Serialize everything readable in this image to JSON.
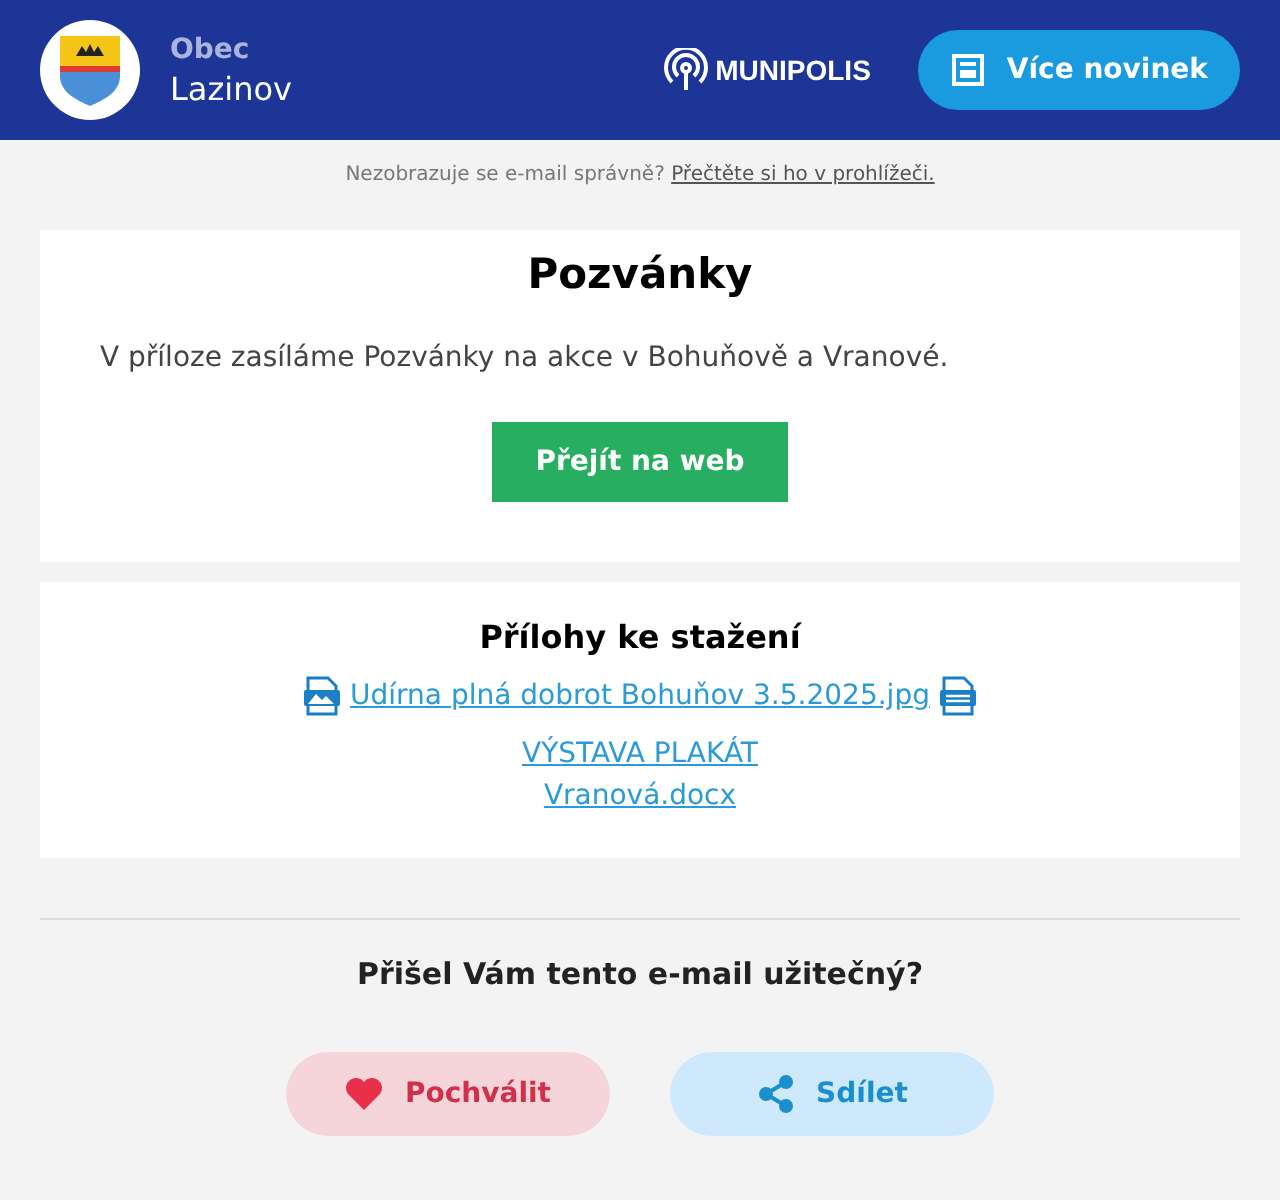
{
  "header": {
    "village_label": "Obec",
    "village_name": "Lazinov",
    "brand": "MUNIPOLIS",
    "more_button": "Více novinek"
  },
  "notice": {
    "text": "Nezobrazuje se e-mail správně?",
    "link": "Přečtěte si ho v prohlížeči."
  },
  "article": {
    "title": "Pozvánky",
    "body": "V příloze zasíláme Pozvánky na akce v Bohuňově a Vranové.",
    "button": "Přejít na web"
  },
  "attachments": {
    "title": "Přílohy ke stažení",
    "files": [
      {
        "kind": "jpg",
        "name": "Udírna plná dobrot Bohuňov 3.5.2025.jpg"
      },
      {
        "kind": "txt",
        "name": "VÝSTAVA PLAKÁT Vranová.docx"
      }
    ]
  },
  "feedback": {
    "question": "Přišel Vám tento e-mail užitečný?",
    "buttons": [
      {
        "kind": "like",
        "label": "Pochválit"
      },
      {
        "kind": "share",
        "label": "Sdílet"
      }
    ]
  }
}
